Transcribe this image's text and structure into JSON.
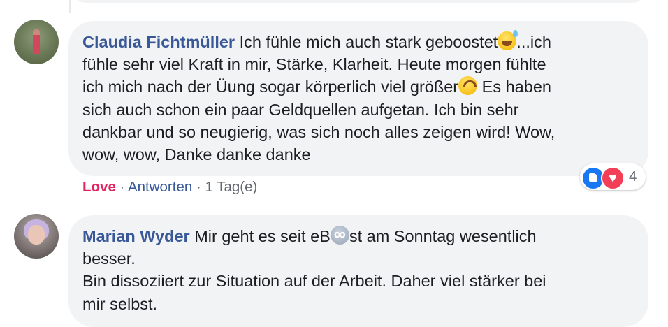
{
  "comments": [
    {
      "author": "Claudia Fichtmüller",
      "lines": [
        {
          "before": "Ich fühle mich auch stark geboostet",
          "emoji": "grinning-sweat-emoji",
          "after": "...ich"
        },
        {
          "before": "fühle sehr viel Kraft in mir, Stärke, Klarheit. Heute morgen fühlte",
          "emoji": "",
          "after": ""
        },
        {
          "before": "ich mich nach der Üung sogar körperlich viel größer",
          "emoji": "upside-down-face-emoji",
          "after": " Es haben"
        },
        {
          "before": "sich auch schon ein paar Geldquellen aufgetan. Ich bin sehr",
          "emoji": "",
          "after": ""
        },
        {
          "before": "dankbar und so neugierig, was sich noch alles zeigen wird! Wow,",
          "emoji": "",
          "after": ""
        },
        {
          "before": "wow, wow, Danke danke danke",
          "emoji": "",
          "after": ""
        }
      ],
      "actions": {
        "love": "Love",
        "sep": " · ",
        "reply": "Antworten",
        "time": "1 Tag(e)"
      },
      "reactions": {
        "count": "4",
        "types": [
          "like",
          "love"
        ]
      }
    },
    {
      "author": "Marian Wyder",
      "line1_before": "Mir geht es seit eB",
      "line1_emoji": "infinity-emoji",
      "line1_after": "st am Sonntag wesentlich",
      "line2": "besser.",
      "line3": "Bin dissoziiert zur Situation auf der Arbeit. Daher viel stärker bei",
      "line4": "mir selbst."
    }
  ],
  "colors": {
    "link": "#385898",
    "love": "#e0245e",
    "meta": "#606770",
    "bubble": "#f2f3f5"
  }
}
